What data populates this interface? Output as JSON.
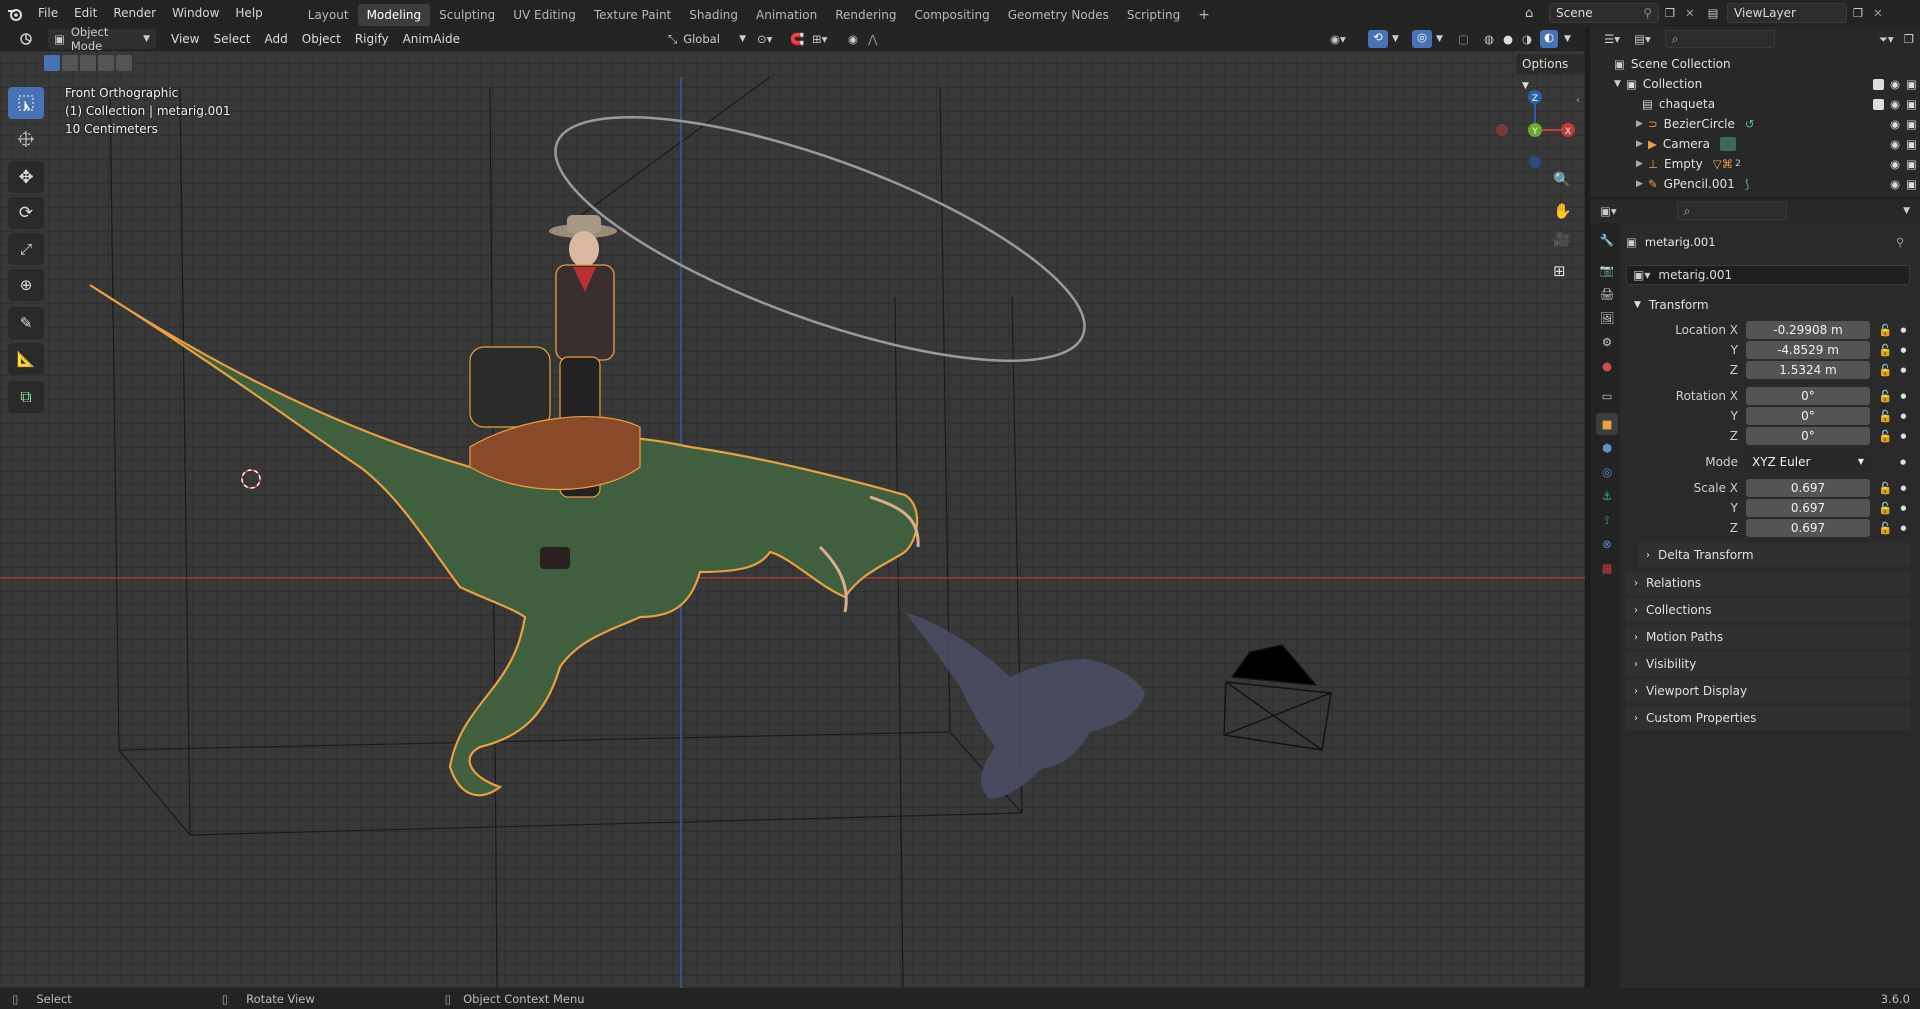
{
  "topbar": {
    "menus": [
      "File",
      "Edit",
      "Render",
      "Window",
      "Help"
    ],
    "workspaces": [
      "Layout",
      "Modeling",
      "Sculpting",
      "UV Editing",
      "Texture Paint",
      "Shading",
      "Animation",
      "Rendering",
      "Compositing",
      "Geometry Nodes",
      "Scripting"
    ],
    "active_workspace": "Modeling",
    "scene": "Scene",
    "view_layer": "ViewLayer"
  },
  "viewport_header": {
    "mode": "Object Mode",
    "menus": [
      "View",
      "Select",
      "Add",
      "Object",
      "Rigify",
      "AnimAide"
    ],
    "transform_orientation": "Global",
    "options_label": "Options"
  },
  "viewport_overlay": {
    "view_name": "Front Orthographic",
    "collection_info": "(1) Collection | metarig.001",
    "grid_scale": "10 Centimeters"
  },
  "gizmo": {
    "x": "X",
    "y": "Y",
    "z": "Z"
  },
  "outliner": {
    "root": "Scene Collection",
    "collection": "Collection",
    "items": [
      "chaqueta",
      "BezierCircle",
      "Camera",
      "Empty",
      "GPencil.001"
    ],
    "empty_badge": "2"
  },
  "properties": {
    "object_name": "metarig.001",
    "data_name": "metarig.001",
    "transform_title": "Transform",
    "location_label": "Location X",
    "location": [
      "-0.29908 m",
      "-4.8529 m",
      "1.5324 m"
    ],
    "rotation_label": "Rotation X",
    "rotation": [
      "0°",
      "0°",
      "0°"
    ],
    "mode_label": "Mode",
    "mode_value": "XYZ Euler",
    "scale_label": "Scale X",
    "scale": [
      "0.697",
      "0.697",
      "0.697"
    ],
    "axis_y": "Y",
    "axis_z": "Z",
    "delta_transform": "Delta Transform",
    "sections": [
      "Relations",
      "Collections",
      "Motion Paths",
      "Visibility",
      "Viewport Display",
      "Custom Properties"
    ]
  },
  "statusbar": {
    "select": "Select",
    "rotate": "Rotate View",
    "context": "Object Context Menu",
    "version": "3.6.0"
  },
  "colors": {
    "accent": "#4772b3",
    "selection_outline": "#e8a040",
    "x_axis": "#c23b3b",
    "z_axis": "#2e5ea8"
  }
}
